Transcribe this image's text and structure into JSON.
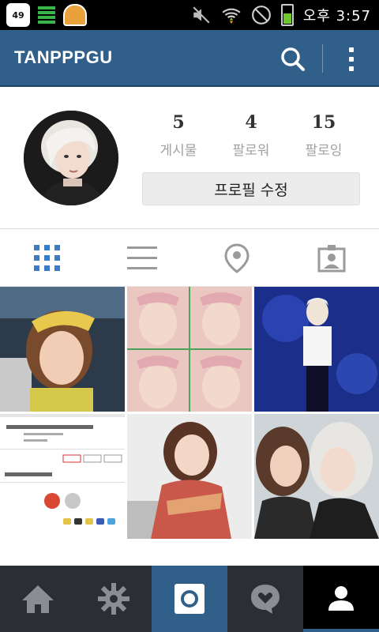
{
  "status_bar": {
    "notification_badge": "49",
    "time": "오후 3:57",
    "icons": [
      "sticker-icon",
      "sim-bars-icon",
      "cupcake-icon",
      "mute-icon",
      "wifi-icon",
      "blocked-icon",
      "battery-icon"
    ],
    "battery_level": 0.55
  },
  "app_bar": {
    "username": "TANPPPGU",
    "icons": [
      "search-icon",
      "more-vert-icon"
    ]
  },
  "profile": {
    "stats": [
      {
        "value": "5",
        "label": "게시물"
      },
      {
        "value": "4",
        "label": "팔로워"
      },
      {
        "value": "15",
        "label": "팔로잉"
      }
    ],
    "edit_button": "프로필 수정"
  },
  "view_tabs": [
    "grid-view-icon",
    "list-view-icon",
    "location-pin-icon",
    "tagged-photos-icon"
  ],
  "bottom_nav": [
    "home-icon",
    "explore-icon",
    "camera-icon",
    "activity-icon",
    "profile-icon"
  ],
  "colors": {
    "brand_blue": "#305f8a",
    "accent_blue": "#3b7dc4",
    "bottom_nav": "#2b2f33",
    "icon_gray": "#9a9a9a"
  }
}
